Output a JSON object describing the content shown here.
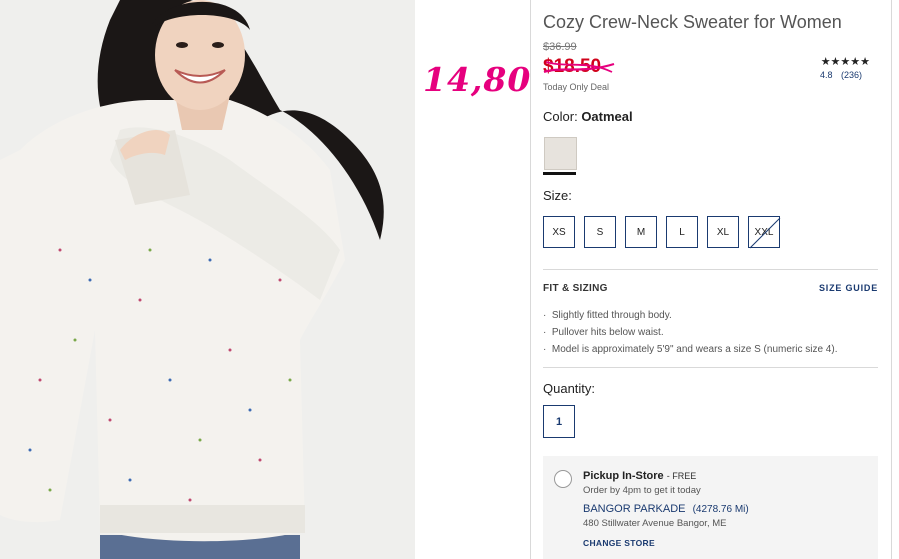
{
  "product": {
    "title": "Cozy Crew-Neck Sweater for Women",
    "original_price": "$36.99",
    "sale_price": "$18.50",
    "deal_label": "Today Only Deal",
    "handwritten_price": "14,80",
    "rating": {
      "stars": "★★★★★",
      "score": "4.8",
      "count": "(236)"
    }
  },
  "color": {
    "label": "Color:",
    "selected": "Oatmeal",
    "swatch_hex": "#e7e3dd"
  },
  "size": {
    "label": "Size:",
    "options": [
      {
        "label": "XS",
        "available": true
      },
      {
        "label": "S",
        "available": true
      },
      {
        "label": "M",
        "available": true
      },
      {
        "label": "L",
        "available": true
      },
      {
        "label": "XL",
        "available": true
      },
      {
        "label": "XXL",
        "available": false
      }
    ]
  },
  "fit": {
    "title": "FIT & SIZING",
    "size_guide_label": "SIZE GUIDE",
    "bullets": [
      "Slightly fitted through body.",
      "Pullover hits below waist.",
      "Model is approximately 5'9\" and wears a size S (numeric size 4)."
    ]
  },
  "quantity": {
    "label": "Quantity:",
    "value": "1"
  },
  "pickup": {
    "title": "Pickup In-Store",
    "free_label": "- FREE",
    "subtitle": "Order by 4pm to get it today",
    "store_name": "BANGOR PARKADE",
    "distance": "(4278.76 Mi)",
    "address": "480 Stillwater Avenue Bangor, ME",
    "change_label": "CHANGE STORE"
  },
  "colors": {
    "accent_navy": "#1a3a70",
    "sale_red": "#d0021b",
    "annotation_pink": "#e6007e"
  }
}
